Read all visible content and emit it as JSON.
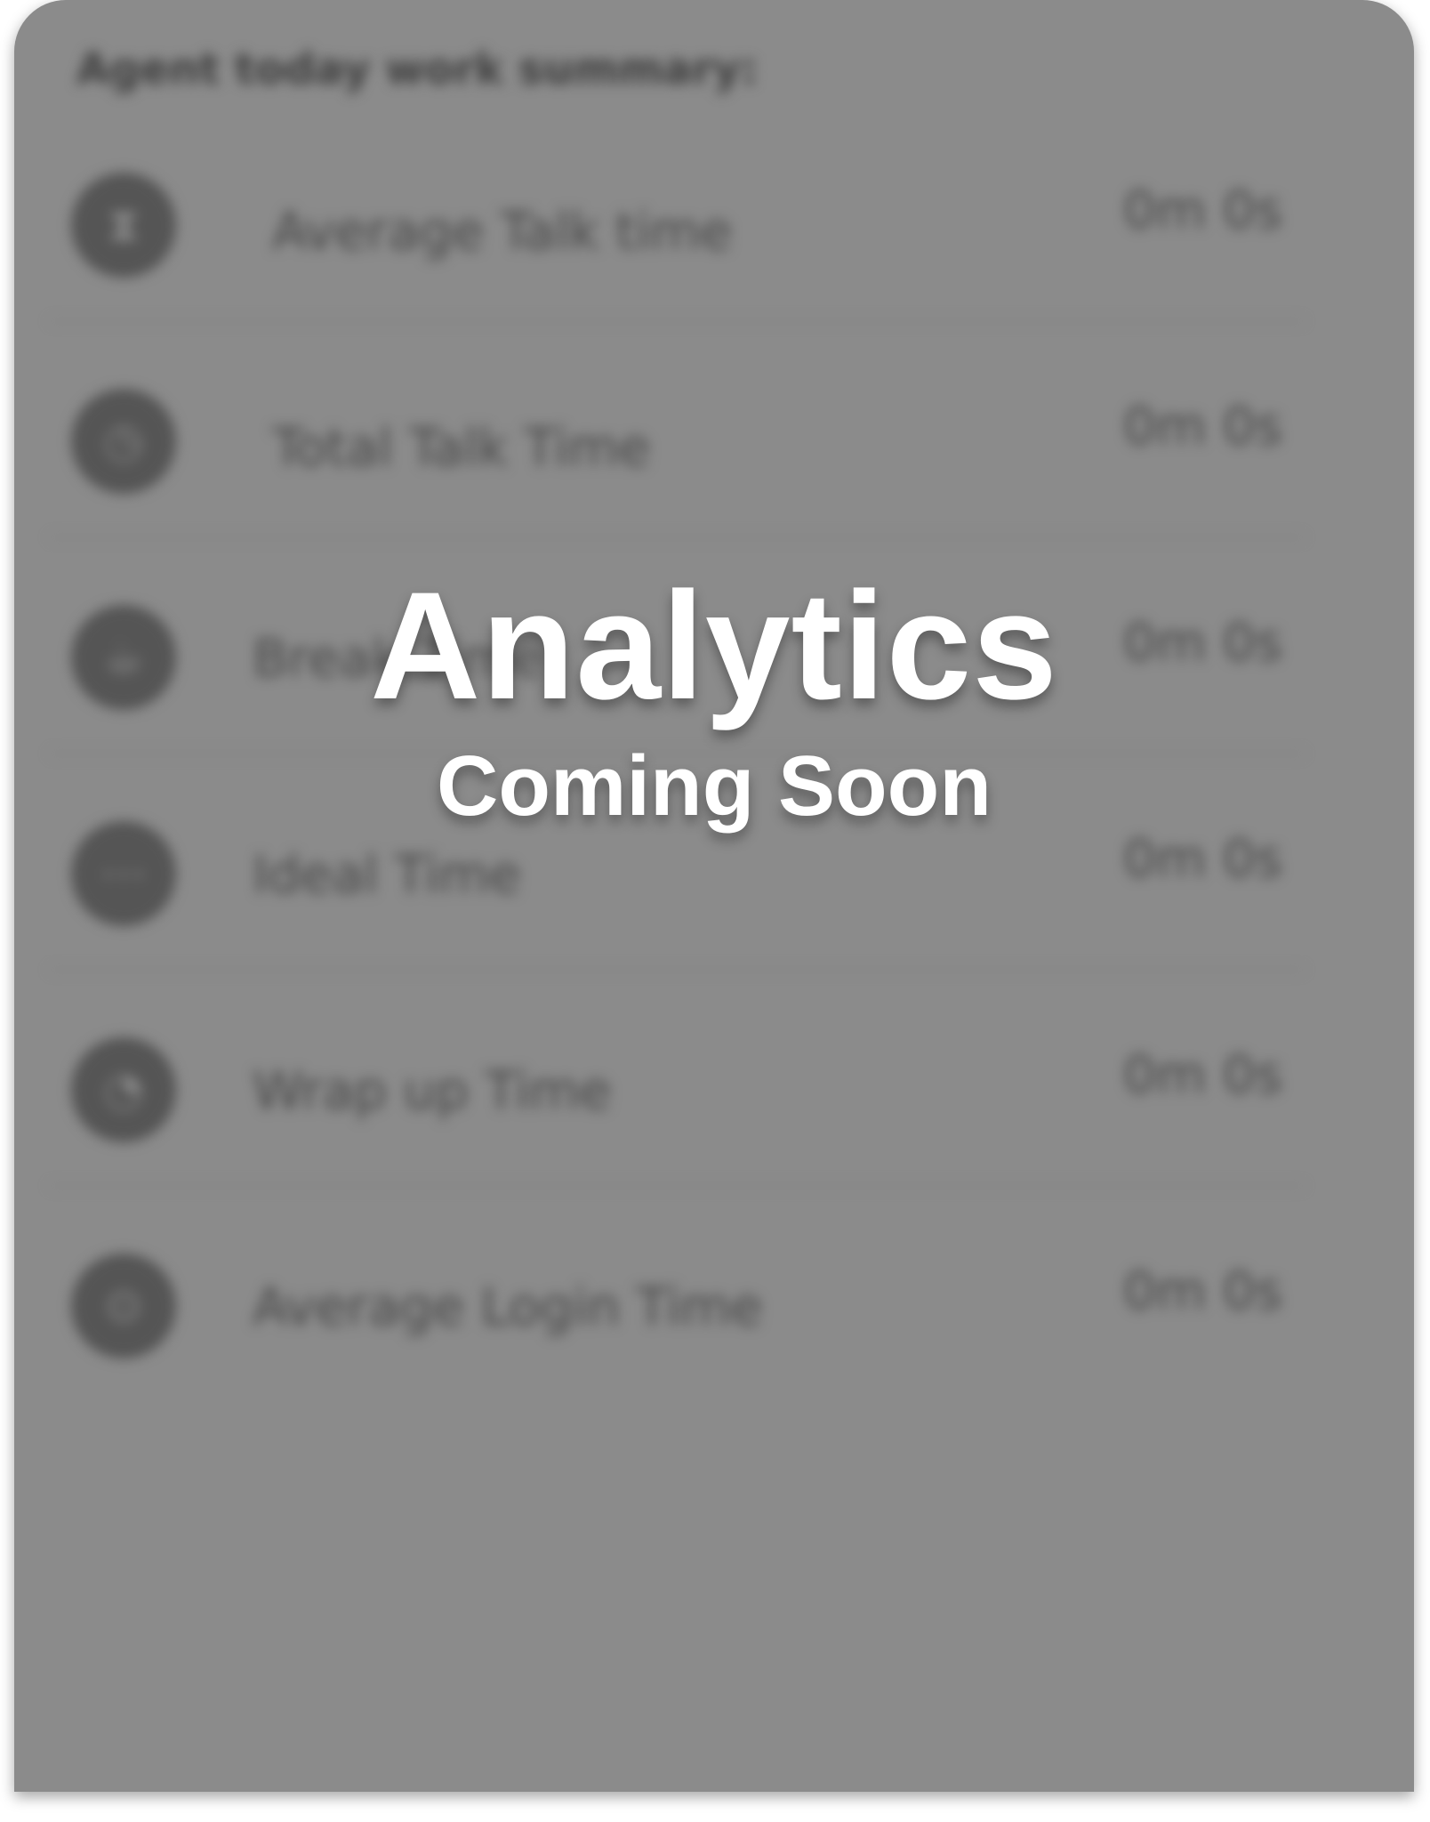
{
  "summary": {
    "title": "Agent today work summary:",
    "metrics": [
      {
        "icon": "hourglass-icon",
        "icon_glyph": "⧗",
        "label": "Average Talk time",
        "value": "0m 0s"
      },
      {
        "icon": "clock-icon",
        "icon_glyph": "◷",
        "label": "Total Talk Time",
        "value": "0m 0s"
      },
      {
        "icon": "coffee-icon",
        "icon_glyph": "☕",
        "label": "Break Time",
        "value": "0m 0s"
      },
      {
        "icon": "idle-icon",
        "icon_glyph": "⋯",
        "label": "Ideal Time",
        "value": "0m 0s"
      },
      {
        "icon": "timer-icon",
        "icon_glyph": "◔",
        "label": "Wrap up Time",
        "value": "0m 0s"
      },
      {
        "icon": "login-icon",
        "icon_glyph": "⊙",
        "label": "Average Login Time",
        "value": "0m 0s"
      }
    ]
  },
  "overlay": {
    "title": "Analytics",
    "subtitle": "Coming Soon"
  },
  "colors": {
    "card_background": "#8b8b8b",
    "overlay_text": "#ffffff"
  }
}
